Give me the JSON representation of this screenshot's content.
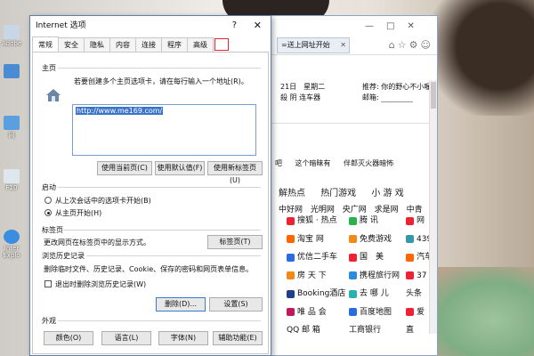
{
  "background_colors": {
    "accent": "#3b73c9",
    "highlight_red": "#e23333"
  },
  "desktop_icons": [
    {
      "label": "Adobe",
      "icon": "app-icon"
    },
    {
      "label": "",
      "icon": "pc-icon"
    },
    {
      "label": "回收站",
      "icon": "recycle-icon"
    },
    {
      "label": "网",
      "icon": "network-icon"
    },
    {
      "label": "F10",
      "icon": "folder-icon"
    },
    {
      "label": "Inter Explo",
      "icon": "ie-icon"
    }
  ],
  "browser": {
    "tab_label": "=送上网址开始",
    "toolbar_icons": [
      "home-icon",
      "star-icon",
      "gear-icon",
      "smile-icon"
    ],
    "window_controls": [
      "—",
      "□",
      "✕"
    ],
    "info_lines": [
      "21日　星期二",
      "殺 阴  连车器"
    ],
    "right_lines": [
      "推荐: 你的野心不小喔",
      "邮箱:"
    ],
    "hot_items": [
      "吧",
      "这个暗昧有",
      "伴郎灭火器暗怖"
    ],
    "category_row": [
      "解热点",
      "热门游戏",
      "小 游 戏"
    ],
    "links": [
      "中好网",
      "光明网",
      "央广网",
      "求是网",
      "中青"
    ],
    "grid": [
      [
        "搜狐 · 热点",
        "腾 讯",
        "网"
      ],
      [
        "淘宝 网",
        "免费游戏",
        "439"
      ],
      [
        "优信二手车",
        "国　美",
        "汽车"
      ],
      [
        "房 天 下",
        "携程旅行网",
        "37"
      ],
      [
        "Booking酒店",
        "去 哪 儿",
        "头条"
      ],
      [
        "唯 品 会",
        "百度地图",
        "爱"
      ],
      [
        "QQ 邮 箱",
        "工商银行",
        "直"
      ]
    ]
  },
  "dialog": {
    "title": "Internet 选项",
    "help_label": "?",
    "close_label": "✕",
    "tabs": [
      "常规",
      "安全",
      "隐私",
      "内容",
      "连接",
      "程序",
      "高级"
    ],
    "active_tab": "常规",
    "home": {
      "section": "主页",
      "instruction": "若要创建多个主页选项卡，请在每行输入一个地址(R)。",
      "url": "http://www.me169.com/",
      "buttons": [
        "使用当前页(C)",
        "使用默认值(F)",
        "使用新标签页(U)"
      ]
    },
    "startup": {
      "section": "启动",
      "options": [
        "从上次会话中的选项卡开始(B)",
        "从主页开始(H)"
      ],
      "selected": 1
    },
    "tabs_section": {
      "section": "标签页",
      "text": "更改网页在标签页中的显示方式。",
      "button": "标签页(T)"
    },
    "history": {
      "section": "浏览历史记录",
      "text": "删除临时文件、历史记录、Cookie、保存的密码和网页表单信息。",
      "checkbox": "退出时删除浏览历史记录(W)",
      "buttons": [
        "删除(D)...",
        "设置(S)"
      ]
    },
    "appearance": {
      "section": "外观",
      "buttons": [
        "颜色(O)",
        "语言(L)",
        "字体(N)",
        "辅助功能(E)"
      ]
    }
  }
}
